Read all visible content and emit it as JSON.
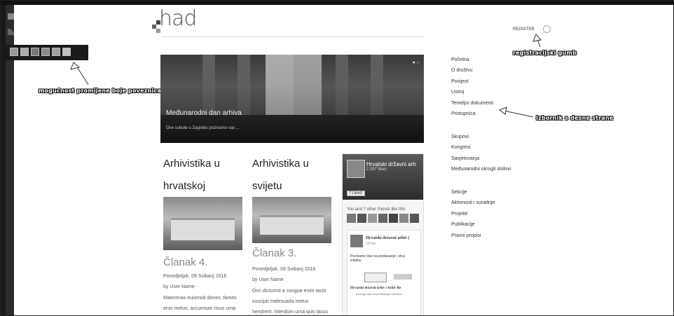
{
  "logo": {
    "text": "had"
  },
  "header": {
    "register_label": "REGISTER"
  },
  "hero": {
    "title": "Međunarodni dan arhiva",
    "subtitle": "Ove subote u Zagrebu pozivamo vas ..."
  },
  "columns": [
    {
      "title_line1": "Arhivistika u",
      "title_line2": "hrvatskoj",
      "article_title": "Članak 4.",
      "date": "Ponedjeljak, 09 Svibanj 2016",
      "author": "by User Name",
      "excerpt_line1": "Maecenas euismod donec, fames",
      "excerpt_line2": "eros metus, accumsan risus urna"
    },
    {
      "title_line1": "Arhivistika u",
      "title_line2": "svijetu",
      "article_title": "Članak 3.",
      "date": "Ponedjeljak, 09 Svibanj 2016",
      "author": "by User Name",
      "excerpt_line1": "Orci dictumst a congue enim taciti",
      "excerpt_line2": "suscipit malesuada metus",
      "excerpt_line3": "hendrerit. Interdum urna quis lacus"
    }
  ],
  "facebook": {
    "page_name": "Hrvatski državni arh",
    "likes": "2.397 likes",
    "liked_label": "Liked",
    "friends": "You and 7 other friends like this",
    "post_name": "Hrvatski državni arhiv (",
    "post_time": "12 hrs",
    "post_text_line1": "Pozivamo Vas na predavanje i strui",
    "post_text_line2": "izlažbu.",
    "doc_title": "Hrvatski državni arhiv i Arhiv Re",
    "doc_sub": "pozivaju Vas na predavanje i stručno i"
  },
  "menu_groups": [
    [
      "Početna",
      "O društvu",
      "Povijest",
      "Ustroj",
      "Temeljni dokumenti",
      "Pristupnica"
    ],
    [
      "Skupovi",
      "Kongresi",
      "Savjetovanja",
      "Međunarodni okrugli stolovi"
    ],
    [
      "Sekcije",
      "Aktivnosti i suradnje",
      "Projekti",
      "Publikacije",
      "Pravni propisi"
    ]
  ],
  "annotations": {
    "link_colors": "mogućnost promijene boje poveznica",
    "register_button": "registracijski gumb",
    "right_menu": "Izbornik s desne strane"
  },
  "colors": {
    "annotation_text": "#ffffff",
    "sidebar": "#1a1a1a"
  }
}
